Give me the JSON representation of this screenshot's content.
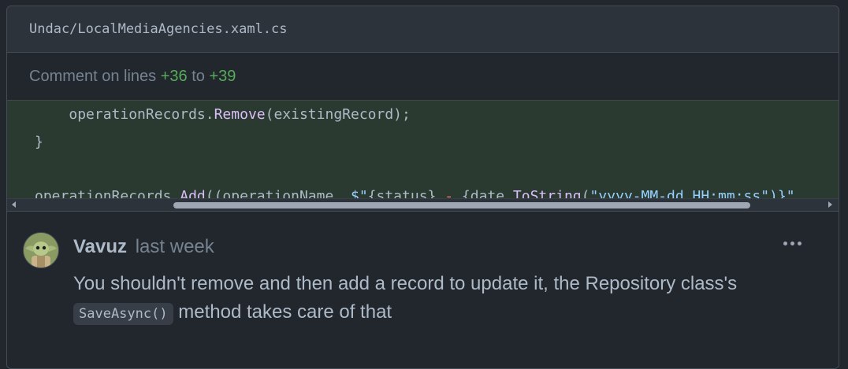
{
  "file": {
    "path": "Undac/LocalMediaAgencies.xaml.cs"
  },
  "comment_range": {
    "prefix": "Comment on lines",
    "start": "+36",
    "joiner": "to",
    "end": "+39"
  },
  "code": {
    "line1": {
      "indent": "    ",
      "obj": "operationRecords.",
      "method": "Remove",
      "rest": "(existingRecord);"
    },
    "line2": "}",
    "line4": {
      "obj": "operationRecords.",
      "method": "Add",
      "args1": "((operationName, ",
      "interp_start": "$\"",
      "interp_open": "{status} ",
      "dash": "-",
      "interp_mid": " {date.",
      "method2": "ToString",
      "paren": "(",
      "fmt": "\"yyyy-MM-dd HH:mm:ss\"",
      "tail": ")}\""
    }
  },
  "comment": {
    "author": "Vavuz",
    "time": "last week",
    "body_before": "You shouldn't remove and then add a record to update it, the Repository class's ",
    "code_ref": "SaveAsync()",
    "body_after": " method takes care of that"
  },
  "icons": {
    "avatar": "baby-yoda-avatar",
    "more": "kebab-menu-icon"
  },
  "colors": {
    "green": "#57ab5a",
    "added_bg": "#2b3a30",
    "method": "#dcbdfb",
    "string": "#96d0ff"
  }
}
